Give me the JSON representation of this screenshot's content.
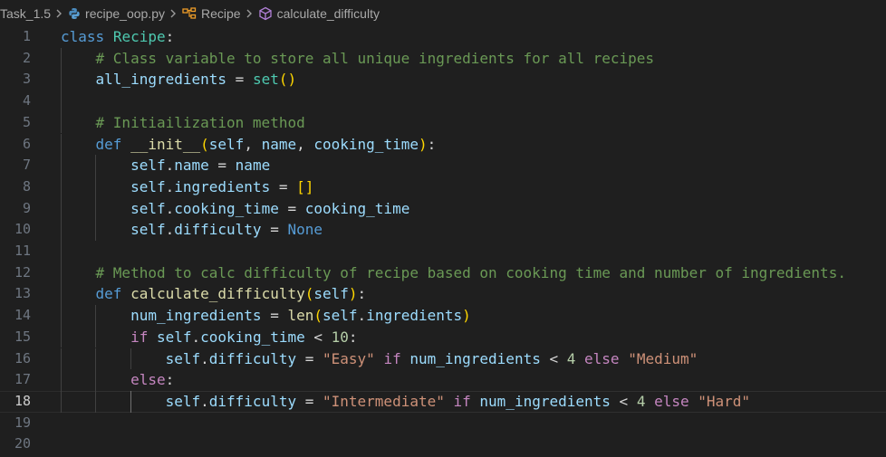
{
  "breadcrumb": {
    "folder": "Task_1.5",
    "file": "recipe_oop.py",
    "class_symbol": "Recipe",
    "method_symbol": "calculate_difficulty",
    "icons": [
      "chevron-right-icon",
      "python-file-icon",
      "class-symbol-icon",
      "method-symbol-icon"
    ]
  },
  "editor": {
    "current_line": 18,
    "line_numbers": [
      "1",
      "2",
      "3",
      "4",
      "5",
      "6",
      "7",
      "8",
      "9",
      "10",
      "11",
      "12",
      "13",
      "14",
      "15",
      "16",
      "17",
      "18",
      "19",
      "20"
    ],
    "lines": [
      [
        [
          "kw",
          "class"
        ],
        [
          "plain",
          " "
        ],
        [
          "cls",
          "Recipe"
        ],
        [
          "plain",
          ":"
        ]
      ],
      [
        [
          "plain",
          "    "
        ],
        [
          "cmt",
          "# Class variable to store all unique ingredients for all recipes"
        ]
      ],
      [
        [
          "plain",
          "    "
        ],
        [
          "var",
          "all_ingredients"
        ],
        [
          "op",
          " = "
        ],
        [
          "cls",
          "set"
        ],
        [
          "p1",
          "()"
        ]
      ],
      [],
      [
        [
          "plain",
          "    "
        ],
        [
          "cmt",
          "# Initiailization method"
        ]
      ],
      [
        [
          "plain",
          "    "
        ],
        [
          "kw",
          "def"
        ],
        [
          "plain",
          " "
        ],
        [
          "fn",
          "__init__"
        ],
        [
          "p1",
          "("
        ],
        [
          "var",
          "self"
        ],
        [
          "plain",
          ", "
        ],
        [
          "var",
          "name"
        ],
        [
          "plain",
          ", "
        ],
        [
          "var",
          "cooking_time"
        ],
        [
          "p1",
          ")"
        ],
        [
          "plain",
          ":"
        ]
      ],
      [
        [
          "plain",
          "        "
        ],
        [
          "var",
          "self"
        ],
        [
          "plain",
          "."
        ],
        [
          "var",
          "name"
        ],
        [
          "op",
          " = "
        ],
        [
          "var",
          "name"
        ]
      ],
      [
        [
          "plain",
          "        "
        ],
        [
          "var",
          "self"
        ],
        [
          "plain",
          "."
        ],
        [
          "var",
          "ingredients"
        ],
        [
          "op",
          " = "
        ],
        [
          "p1",
          "[]"
        ]
      ],
      [
        [
          "plain",
          "        "
        ],
        [
          "var",
          "self"
        ],
        [
          "plain",
          "."
        ],
        [
          "var",
          "cooking_time"
        ],
        [
          "op",
          " = "
        ],
        [
          "var",
          "cooking_time"
        ]
      ],
      [
        [
          "plain",
          "        "
        ],
        [
          "var",
          "self"
        ],
        [
          "plain",
          "."
        ],
        [
          "var",
          "difficulty"
        ],
        [
          "op",
          " = "
        ],
        [
          "kw",
          "None"
        ]
      ],
      [],
      [
        [
          "plain",
          "    "
        ],
        [
          "cmt",
          "# Method to calc difficulty of recipe based on cooking time and number of ingredients."
        ]
      ],
      [
        [
          "plain",
          "    "
        ],
        [
          "kw",
          "def"
        ],
        [
          "plain",
          " "
        ],
        [
          "fn",
          "calculate_difficulty"
        ],
        [
          "p1",
          "("
        ],
        [
          "var",
          "self"
        ],
        [
          "p1",
          ")"
        ],
        [
          "plain",
          ":"
        ]
      ],
      [
        [
          "plain",
          "        "
        ],
        [
          "var",
          "num_ingredients"
        ],
        [
          "op",
          " = "
        ],
        [
          "fn",
          "len"
        ],
        [
          "p1",
          "("
        ],
        [
          "var",
          "self"
        ],
        [
          "plain",
          "."
        ],
        [
          "var",
          "ingredients"
        ],
        [
          "p1",
          ")"
        ]
      ],
      [
        [
          "plain",
          "        "
        ],
        [
          "ctrl",
          "if"
        ],
        [
          "plain",
          " "
        ],
        [
          "var",
          "self"
        ],
        [
          "plain",
          "."
        ],
        [
          "var",
          "cooking_time"
        ],
        [
          "op",
          " < "
        ],
        [
          "num",
          "10"
        ],
        [
          "plain",
          ":"
        ]
      ],
      [
        [
          "plain",
          "            "
        ],
        [
          "var",
          "self"
        ],
        [
          "plain",
          "."
        ],
        [
          "var",
          "difficulty"
        ],
        [
          "op",
          " = "
        ],
        [
          "str",
          "\"Easy\""
        ],
        [
          "plain",
          " "
        ],
        [
          "ctrl",
          "if"
        ],
        [
          "plain",
          " "
        ],
        [
          "var",
          "num_ingredients"
        ],
        [
          "op",
          " < "
        ],
        [
          "num",
          "4"
        ],
        [
          "plain",
          " "
        ],
        [
          "ctrl",
          "else"
        ],
        [
          "plain",
          " "
        ],
        [
          "str",
          "\"Medium\""
        ]
      ],
      [
        [
          "plain",
          "        "
        ],
        [
          "ctrl",
          "else"
        ],
        [
          "plain",
          ":"
        ]
      ],
      [
        [
          "plain",
          "            "
        ],
        [
          "var",
          "self"
        ],
        [
          "plain",
          "."
        ],
        [
          "var",
          "difficulty"
        ],
        [
          "op",
          " = "
        ],
        [
          "str",
          "\"Intermediate\""
        ],
        [
          "plain",
          " "
        ],
        [
          "ctrl",
          "if"
        ],
        [
          "plain",
          " "
        ],
        [
          "var",
          "num_ingredients"
        ],
        [
          "op",
          " < "
        ],
        [
          "num",
          "4"
        ],
        [
          "plain",
          " "
        ],
        [
          "ctrl",
          "else"
        ],
        [
          "plain",
          " "
        ],
        [
          "str",
          "\"Hard\""
        ]
      ],
      [],
      []
    ]
  },
  "colors": {
    "background": "#1f1f1f",
    "keyword": "#569cd6",
    "control": "#c586c0",
    "class": "#4ec9b0",
    "function": "#dcdcaa",
    "variable": "#9cdcfe",
    "string": "#ce9178",
    "number": "#b5cea8",
    "comment": "#6a9955",
    "bracket": "#ffd700"
  }
}
